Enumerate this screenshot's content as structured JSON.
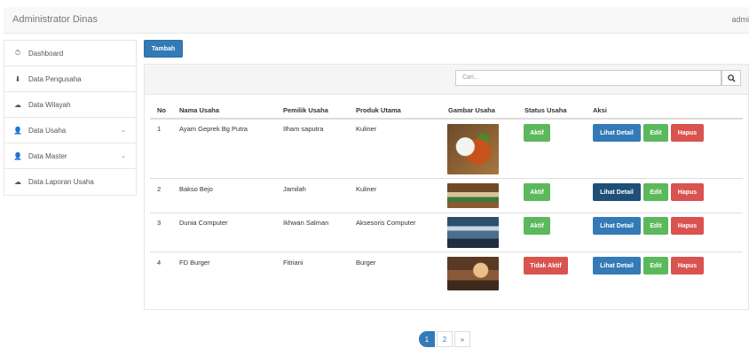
{
  "header": {
    "brand": "Administrator Dinas",
    "user": "admi"
  },
  "sidebar": {
    "items": [
      {
        "label": "Dashboard",
        "icon": "⏱"
      },
      {
        "label": "Data Pengusaha",
        "icon": "⬇"
      },
      {
        "label": "Data Wilayah",
        "icon": "☁"
      },
      {
        "label": "Data Usaha",
        "icon": "👤"
      },
      {
        "label": "Data Master",
        "icon": "👤"
      },
      {
        "label": "Data Laporan Usaha",
        "icon": "☁"
      }
    ],
    "chevron": "⌄"
  },
  "toolbar": {
    "add_label": "Tambah"
  },
  "search": {
    "placeholder": "Cari..."
  },
  "table": {
    "headers": [
      "No",
      "Nama Usaha",
      "Pemilik Usaha",
      "Produk Utama",
      "Gambar Usaha",
      "Status Usaha",
      "Aksi"
    ],
    "rows": [
      {
        "no": "1",
        "nama": "Ayam Geprek Bg Putra",
        "pemilik": "Ilham saputra",
        "produk": "Kuliner",
        "status": "Aktif"
      },
      {
        "no": "2",
        "nama": "Bakso Bejo",
        "pemilik": "Jamilah",
        "produk": "Kuliner",
        "status": "Aktif"
      },
      {
        "no": "3",
        "nama": "Dunia Computer",
        "pemilik": "Ikhwan Salman",
        "produk": "Aksesoris Computer",
        "status": "Aktif"
      },
      {
        "no": "4",
        "nama": "FD Burger",
        "pemilik": "Fitriani",
        "produk": "Burger",
        "status": "Tidak Aktif"
      }
    ],
    "actions": {
      "detail": "Lihat Detail",
      "edit": "Edit",
      "hapus": "Hapus"
    }
  },
  "pagination": {
    "pages": [
      "1",
      "2"
    ],
    "next": "»"
  },
  "colors": {
    "primary": "#337ab7",
    "success": "#5cb85c",
    "danger": "#d9534f"
  }
}
